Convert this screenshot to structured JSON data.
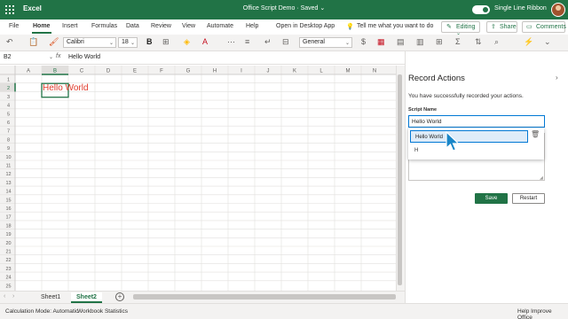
{
  "titlebar": {
    "app_name": "Excel",
    "doc_title": "Office Script Demo · Saved ⌄",
    "toggle_label": "Single Line Ribbon"
  },
  "menu": {
    "items": [
      "File",
      "Home",
      "Insert",
      "Formulas",
      "Data",
      "Review",
      "View",
      "Automate",
      "Help",
      "Open in Desktop App"
    ],
    "active": "Home",
    "tell_me": "Tell me what you want to do",
    "editing": "Editing",
    "share": "Share",
    "comments": "Comments"
  },
  "ribbon": {
    "font": "Calibri",
    "font_size": "18",
    "number_format": "General"
  },
  "formula_bar": {
    "name_box": "B2",
    "fx": "fx",
    "value": "Hello World"
  },
  "grid": {
    "columns": [
      "A",
      "B",
      "C",
      "D",
      "E",
      "F",
      "G",
      "H",
      "I",
      "J",
      "K",
      "L",
      "M",
      "N"
    ],
    "rows": [
      "1",
      "2",
      "3",
      "4",
      "5",
      "6",
      "7",
      "8",
      "9",
      "10",
      "11",
      "12",
      "13",
      "14",
      "15",
      "16",
      "17",
      "18",
      "19",
      "20",
      "21",
      "22",
      "23",
      "24",
      "25"
    ],
    "cell_b2": "Hello World",
    "selected_cell": "B2",
    "cell_text_color": "#e03b2c"
  },
  "sheets": {
    "tabs": [
      "Sheet1",
      "Sheet2"
    ],
    "active": "Sheet2",
    "add_icon": "plus-circle-icon"
  },
  "status_bar": {
    "calc_mode": "Calculation Mode: Automatic",
    "workbook_stats": "Workbook Statistics",
    "help_improve": "Help Improve Office"
  },
  "pane": {
    "title": "Record Actions",
    "close": "›",
    "message": "You have successfully recorded your actions.",
    "script_name_label": "Script Name",
    "script_name_value": "Hello World",
    "autocomplete_items": [
      "Hello World",
      "H"
    ],
    "save": "Save",
    "restart": "Restart"
  },
  "colors": {
    "brand": "#217346",
    "accent": "#0078d4"
  }
}
